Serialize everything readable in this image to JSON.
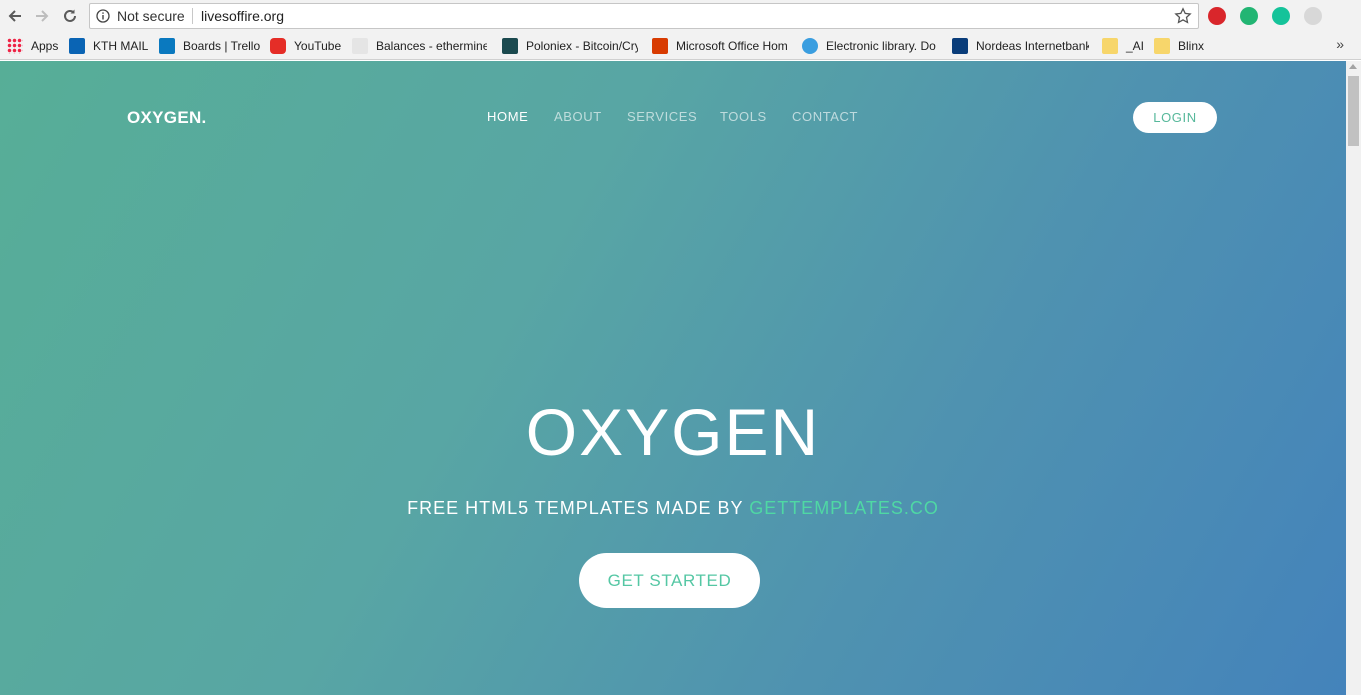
{
  "browser": {
    "security_label": "Not secure",
    "url": "livesoffire.org",
    "bookmarks": [
      {
        "label": "Apps",
        "icon": "apps-grid-icon"
      },
      {
        "label": "KTH MAIL",
        "icon": "outlook-icon"
      },
      {
        "label": "Boards | Trello",
        "icon": "trello-icon"
      },
      {
        "label": "YouTube",
        "icon": "youtube-icon"
      },
      {
        "label": "Balances - ethermine",
        "icon": "ethermine-icon"
      },
      {
        "label": "Poloniex - Bitcoin/Cry",
        "icon": "poloniex-icon"
      },
      {
        "label": "Microsoft Office Hom",
        "icon": "office-icon"
      },
      {
        "label": "Electronic library. Do",
        "icon": "globe-icon"
      },
      {
        "label": "Nordeas Internetbank",
        "icon": "nordea-icon"
      },
      {
        "label": "_AI",
        "icon": "folder-icon"
      },
      {
        "label": "Blinx",
        "icon": "folder-icon"
      }
    ],
    "overflow_label": "»"
  },
  "site": {
    "brand": "OXYGEN.",
    "nav": [
      "HOME",
      "ABOUT",
      "SERVICES",
      "TOOLS",
      "CONTACT"
    ],
    "active_nav": "HOME",
    "login_label": "LOGIN"
  },
  "hero": {
    "title": "OXYGEN",
    "subtitle_prefix": "FREE HTML5 TEMPLATES MADE BY ",
    "subtitle_link": "GETTEMPLATES.CO",
    "cta_label": "GET STARTED"
  },
  "colors": {
    "gradient_start": "#57ae97",
    "gradient_end": "#4483bb",
    "accent": "#4fd8a4"
  }
}
